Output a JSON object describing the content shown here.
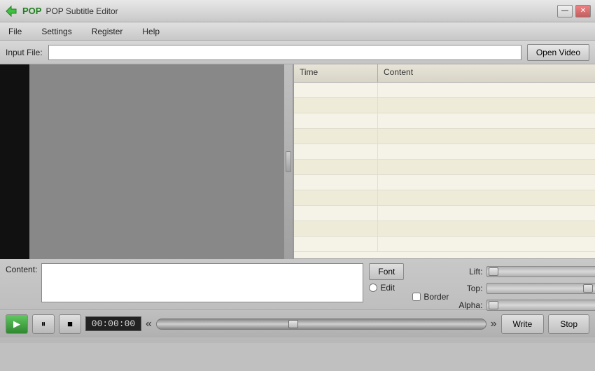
{
  "app": {
    "title": "POP Subtitle Editor",
    "icon_label": "POP"
  },
  "title_controls": {
    "minimize_label": "—",
    "close_label": "✕"
  },
  "menu": {
    "items": [
      "File",
      "Settings",
      "Register",
      "Help"
    ]
  },
  "input_file": {
    "label": "Input File:",
    "placeholder": "",
    "open_button": "Open Video"
  },
  "subtitle_table": {
    "col_time": "Time",
    "col_content": "Content",
    "rows": [
      {
        "time": "",
        "content": ""
      },
      {
        "time": "",
        "content": ""
      },
      {
        "time": "",
        "content": ""
      },
      {
        "time": "",
        "content": ""
      },
      {
        "time": "",
        "content": ""
      },
      {
        "time": "",
        "content": ""
      },
      {
        "time": "",
        "content": ""
      },
      {
        "time": "",
        "content": ""
      },
      {
        "time": "",
        "content": ""
      },
      {
        "time": "",
        "content": ""
      },
      {
        "time": "",
        "content": ""
      }
    ]
  },
  "content_area": {
    "label": "Content:",
    "font_button": "Font",
    "edit_label": "Edit",
    "border_label": "Border"
  },
  "sliders": {
    "lift_label": "Lift:",
    "top_label": "Top:",
    "alpha_label": "Alpha:",
    "lift_value": 0,
    "top_value": 75,
    "alpha_value": 5
  },
  "playback": {
    "play_label": "▶",
    "pause_label": "⏸",
    "stop_label": "■",
    "time_display": "00:00:00",
    "seek_left": "«",
    "seek_right": "»",
    "write_button": "Write",
    "stop_button": "Stop"
  }
}
